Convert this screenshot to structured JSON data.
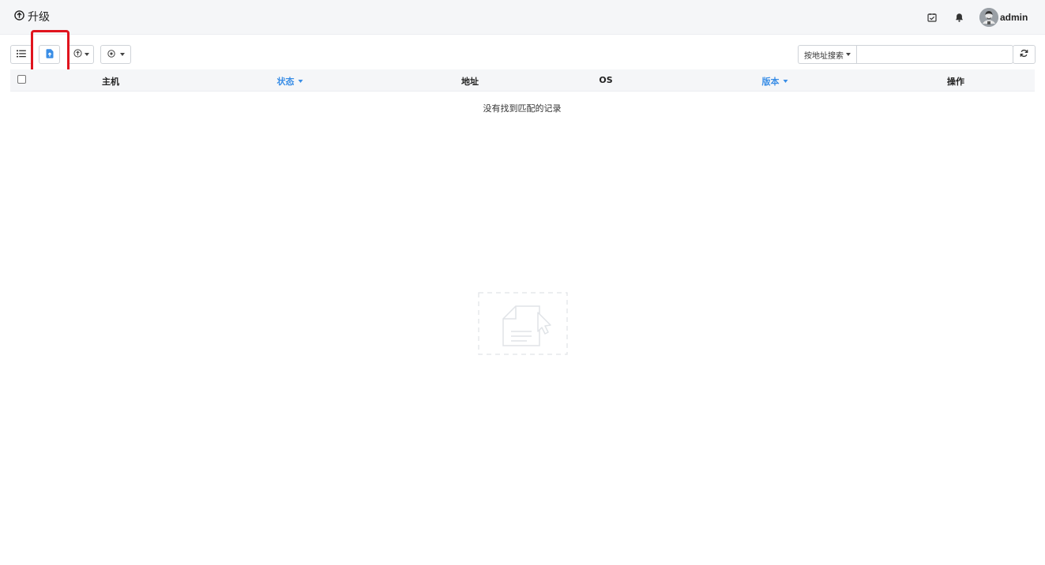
{
  "header": {
    "title": "升级",
    "title_icon": "arrow-up-circle-icon",
    "icons": [
      "calendar-check-icon",
      "bell-icon"
    ],
    "user": {
      "name": "admin",
      "avatar": "avatar"
    }
  },
  "toolbar": {
    "buttons": [
      {
        "icon": "list-icon"
      },
      {
        "icon": "file-upload-icon",
        "highlighted": true
      },
      {
        "icon": "arrow-up-circle-icon",
        "has_dropdown": true
      },
      {
        "icon": "dot-circle-icon",
        "has_dropdown": true
      }
    ],
    "search": {
      "dropdown_label": "按地址搜索",
      "value": "",
      "placeholder": ""
    },
    "refresh_icon": "refresh-icon"
  },
  "table": {
    "columns": [
      {
        "label": "主机",
        "sortable": false
      },
      {
        "label": "状态",
        "sortable": true
      },
      {
        "label": "地址",
        "sortable": false
      },
      {
        "label": "OS",
        "sortable": false
      },
      {
        "label": "版本",
        "sortable": true
      },
      {
        "label": "操作",
        "sortable": false
      }
    ],
    "rows": [],
    "empty_text": "没有找到匹配的记录"
  },
  "colors": {
    "accent": "#3a8ee6",
    "highlight": "#e0141e",
    "header_bg": "#f5f6f8"
  }
}
